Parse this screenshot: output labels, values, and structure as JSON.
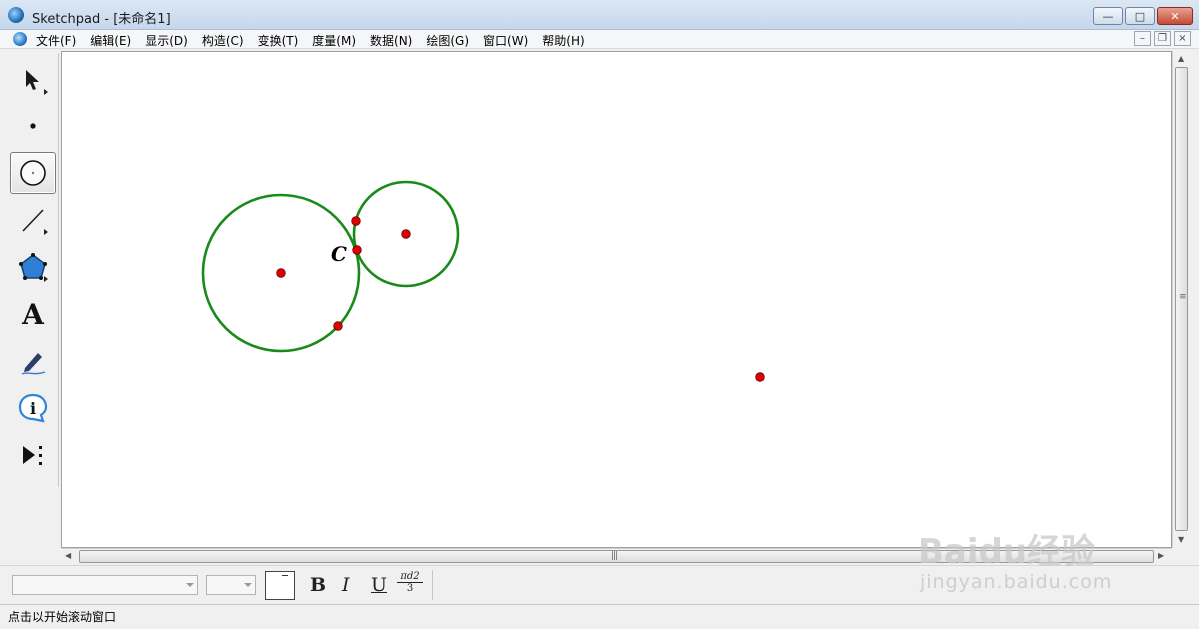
{
  "window": {
    "title": "Sketchpad  - [未命名1]",
    "controls": [
      "minimize-icon",
      "maximize-icon",
      "close-icon"
    ]
  },
  "menu": {
    "items": [
      {
        "label": "文件(F)"
      },
      {
        "label": "编辑(E)"
      },
      {
        "label": "显示(D)"
      },
      {
        "label": "构造(C)"
      },
      {
        "label": "变换(T)"
      },
      {
        "label": "度量(M)"
      },
      {
        "label": "数据(N)"
      },
      {
        "label": "绘图(G)"
      },
      {
        "label": "窗口(W)"
      },
      {
        "label": "帮助(H)"
      }
    ]
  },
  "toolbox": {
    "tools": [
      {
        "name": "arrow-select-tool",
        "icon": "arrow-icon"
      },
      {
        "name": "point-tool",
        "icon": "point-icon"
      },
      {
        "name": "compass-tool",
        "icon": "circle-icon",
        "active": true
      },
      {
        "name": "straightedge-tool",
        "icon": "line-icon"
      },
      {
        "name": "polygon-tool",
        "icon": "pentagon-icon"
      },
      {
        "name": "text-tool",
        "icon": "letter-a-icon",
        "label": "A"
      },
      {
        "name": "marker-tool",
        "icon": "pen-icon"
      },
      {
        "name": "information-tool",
        "icon": "info-icon",
        "label": "i"
      },
      {
        "name": "custom-tool",
        "icon": "play-menu-icon"
      }
    ]
  },
  "canvas": {
    "point_label": "C",
    "colors": {
      "circle_stroke": "#1a8a1a",
      "point_fill": "#e00000"
    }
  },
  "text_toolbar": {
    "font_family_value": "",
    "font_size_value": "",
    "bold": "B",
    "italic": "I",
    "underline": "U",
    "formula_numerator": "πd2",
    "formula_denominator": "3"
  },
  "status": {
    "text": "点击以开始滚动窗口"
  },
  "watermark": {
    "logo": "Baidu经验",
    "url": "jingyan.baidu.com"
  }
}
